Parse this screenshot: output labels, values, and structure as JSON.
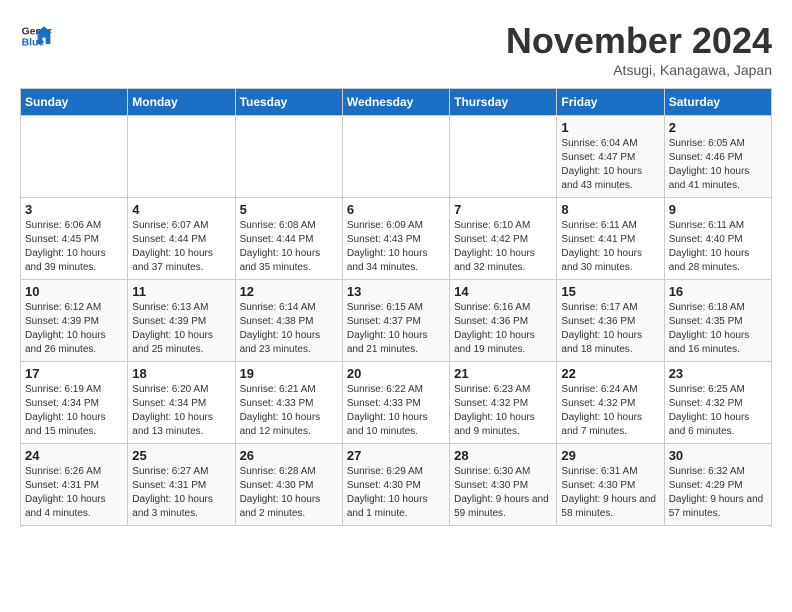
{
  "header": {
    "logo_line1": "General",
    "logo_line2": "Blue",
    "month_title": "November 2024",
    "subtitle": "Atsugi, Kanagawa, Japan"
  },
  "weekdays": [
    "Sunday",
    "Monday",
    "Tuesday",
    "Wednesday",
    "Thursday",
    "Friday",
    "Saturday"
  ],
  "weeks": [
    [
      {
        "day": "",
        "info": ""
      },
      {
        "day": "",
        "info": ""
      },
      {
        "day": "",
        "info": ""
      },
      {
        "day": "",
        "info": ""
      },
      {
        "day": "",
        "info": ""
      },
      {
        "day": "1",
        "info": "Sunrise: 6:04 AM\nSunset: 4:47 PM\nDaylight: 10 hours and 43 minutes."
      },
      {
        "day": "2",
        "info": "Sunrise: 6:05 AM\nSunset: 4:46 PM\nDaylight: 10 hours and 41 minutes."
      }
    ],
    [
      {
        "day": "3",
        "info": "Sunrise: 6:06 AM\nSunset: 4:45 PM\nDaylight: 10 hours and 39 minutes."
      },
      {
        "day": "4",
        "info": "Sunrise: 6:07 AM\nSunset: 4:44 PM\nDaylight: 10 hours and 37 minutes."
      },
      {
        "day": "5",
        "info": "Sunrise: 6:08 AM\nSunset: 4:44 PM\nDaylight: 10 hours and 35 minutes."
      },
      {
        "day": "6",
        "info": "Sunrise: 6:09 AM\nSunset: 4:43 PM\nDaylight: 10 hours and 34 minutes."
      },
      {
        "day": "7",
        "info": "Sunrise: 6:10 AM\nSunset: 4:42 PM\nDaylight: 10 hours and 32 minutes."
      },
      {
        "day": "8",
        "info": "Sunrise: 6:11 AM\nSunset: 4:41 PM\nDaylight: 10 hours and 30 minutes."
      },
      {
        "day": "9",
        "info": "Sunrise: 6:11 AM\nSunset: 4:40 PM\nDaylight: 10 hours and 28 minutes."
      }
    ],
    [
      {
        "day": "10",
        "info": "Sunrise: 6:12 AM\nSunset: 4:39 PM\nDaylight: 10 hours and 26 minutes."
      },
      {
        "day": "11",
        "info": "Sunrise: 6:13 AM\nSunset: 4:39 PM\nDaylight: 10 hours and 25 minutes."
      },
      {
        "day": "12",
        "info": "Sunrise: 6:14 AM\nSunset: 4:38 PM\nDaylight: 10 hours and 23 minutes."
      },
      {
        "day": "13",
        "info": "Sunrise: 6:15 AM\nSunset: 4:37 PM\nDaylight: 10 hours and 21 minutes."
      },
      {
        "day": "14",
        "info": "Sunrise: 6:16 AM\nSunset: 4:36 PM\nDaylight: 10 hours and 19 minutes."
      },
      {
        "day": "15",
        "info": "Sunrise: 6:17 AM\nSunset: 4:36 PM\nDaylight: 10 hours and 18 minutes."
      },
      {
        "day": "16",
        "info": "Sunrise: 6:18 AM\nSunset: 4:35 PM\nDaylight: 10 hours and 16 minutes."
      }
    ],
    [
      {
        "day": "17",
        "info": "Sunrise: 6:19 AM\nSunset: 4:34 PM\nDaylight: 10 hours and 15 minutes."
      },
      {
        "day": "18",
        "info": "Sunrise: 6:20 AM\nSunset: 4:34 PM\nDaylight: 10 hours and 13 minutes."
      },
      {
        "day": "19",
        "info": "Sunrise: 6:21 AM\nSunset: 4:33 PM\nDaylight: 10 hours and 12 minutes."
      },
      {
        "day": "20",
        "info": "Sunrise: 6:22 AM\nSunset: 4:33 PM\nDaylight: 10 hours and 10 minutes."
      },
      {
        "day": "21",
        "info": "Sunrise: 6:23 AM\nSunset: 4:32 PM\nDaylight: 10 hours and 9 minutes."
      },
      {
        "day": "22",
        "info": "Sunrise: 6:24 AM\nSunset: 4:32 PM\nDaylight: 10 hours and 7 minutes."
      },
      {
        "day": "23",
        "info": "Sunrise: 6:25 AM\nSunset: 4:32 PM\nDaylight: 10 hours and 6 minutes."
      }
    ],
    [
      {
        "day": "24",
        "info": "Sunrise: 6:26 AM\nSunset: 4:31 PM\nDaylight: 10 hours and 4 minutes."
      },
      {
        "day": "25",
        "info": "Sunrise: 6:27 AM\nSunset: 4:31 PM\nDaylight: 10 hours and 3 minutes."
      },
      {
        "day": "26",
        "info": "Sunrise: 6:28 AM\nSunset: 4:30 PM\nDaylight: 10 hours and 2 minutes."
      },
      {
        "day": "27",
        "info": "Sunrise: 6:29 AM\nSunset: 4:30 PM\nDaylight: 10 hours and 1 minute."
      },
      {
        "day": "28",
        "info": "Sunrise: 6:30 AM\nSunset: 4:30 PM\nDaylight: 9 hours and 59 minutes."
      },
      {
        "day": "29",
        "info": "Sunrise: 6:31 AM\nSunset: 4:30 PM\nDaylight: 9 hours and 58 minutes."
      },
      {
        "day": "30",
        "info": "Sunrise: 6:32 AM\nSunset: 4:29 PM\nDaylight: 9 hours and 57 minutes."
      }
    ]
  ]
}
